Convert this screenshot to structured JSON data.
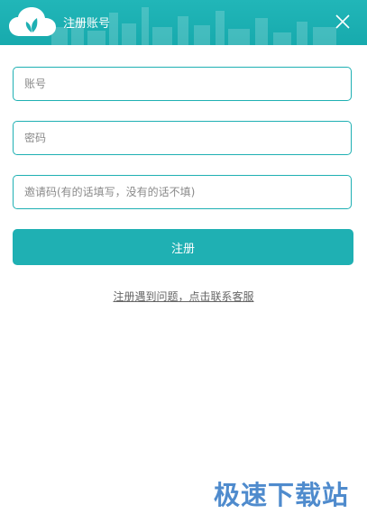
{
  "window": {
    "title": "注册账号",
    "header_color": "#1fb0b3"
  },
  "icons": {
    "logo": "cloud-leaf-icon",
    "close": "close-icon"
  },
  "form": {
    "account_placeholder": "账号",
    "password_placeholder": "密码",
    "invite_placeholder": "邀请码(有的话填写，没有的话不填)",
    "register_label": "注册"
  },
  "help": {
    "link_text": "注册遇到问题，点击联系客服"
  },
  "watermark": {
    "text": "极速下载站"
  },
  "colors": {
    "accent": "#1fb0b3",
    "link": "#666666",
    "watermark": "#3c7fc8"
  }
}
